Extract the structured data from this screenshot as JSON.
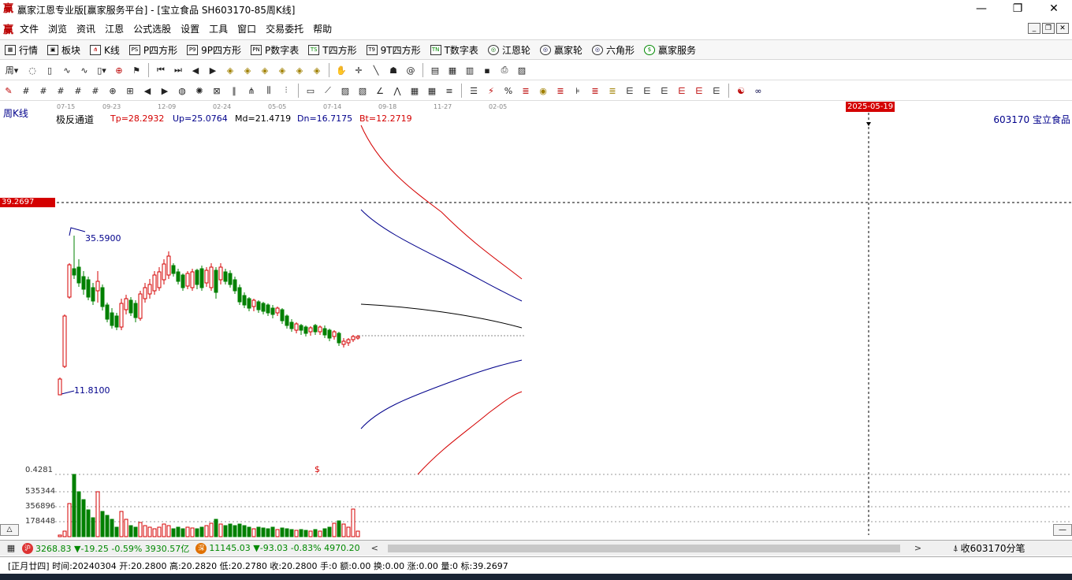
{
  "titlebar": {
    "logo": "赢",
    "title": "赢家江恩专业版[赢家服务平台] - [宝立食品  SH603170-85周K线]",
    "minimize": "—",
    "restore": "❐",
    "close": "✕"
  },
  "menubar": {
    "logo": "赢",
    "items": [
      "文件",
      "浏览",
      "资讯",
      "江恩",
      "公式选股",
      "设置",
      "工具",
      "窗口",
      "交易委托",
      "帮助"
    ],
    "mdi": [
      "_",
      "❐",
      "✕"
    ]
  },
  "navbar": {
    "items": [
      {
        "icon": "quote-grid-icon",
        "glyph": "▦",
        "label": "行情"
      },
      {
        "icon": "sector-icon",
        "glyph": "▣",
        "label": "板块"
      },
      {
        "icon": "kline-icon",
        "glyph": "⋔",
        "label": "K线"
      },
      {
        "icon": "p-square-icon",
        "glyph": "PS",
        "label": "P四方形"
      },
      {
        "icon": "9p-square-icon",
        "glyph": "P9",
        "label": "9P四方形"
      },
      {
        "icon": "p-number-table-icon",
        "glyph": "PN",
        "label": "P数字表"
      },
      {
        "icon": "t-square-icon",
        "glyph": "TS",
        "label": "T四方形"
      },
      {
        "icon": "9t-square-icon",
        "glyph": "T9",
        "label": "9T四方形"
      },
      {
        "icon": "t-number-table-icon",
        "glyph": "TN",
        "label": "T数字表"
      },
      {
        "icon": "gann-wheel-icon",
        "glyph": "◎",
        "label": "江恩轮"
      },
      {
        "icon": "winner-wheel-icon",
        "glyph": "◎",
        "label": "赢家轮"
      },
      {
        "icon": "hexagon-icon",
        "glyph": "◎",
        "label": "六角形"
      },
      {
        "icon": "dollar-icon",
        "glyph": "$",
        "label": "赢家服务"
      }
    ]
  },
  "toolbar1": {
    "period_label": "周"
  },
  "chart": {
    "period_label": "周K线",
    "stock_label": "603170  宝立食品",
    "indicator_name": "极反通道",
    "tp": "Tp=28.2932",
    "up": "Up=25.0764",
    "md": "Md=21.4719",
    "dn": "Dn=16.7175",
    "bt": "Bt=12.2719",
    "date_ticks": [
      "07-15",
      "09-23",
      "12-09",
      "02-24",
      "05-05",
      "07-14",
      "09-18",
      "11-27",
      "02-05"
    ],
    "cursor_date": "2025-05-19",
    "cursor_price": "39.2697",
    "high_label": "35.5900",
    "low_label": "11.8100",
    "volume_labels": [
      "0.4281",
      "535344",
      "356896",
      "178448"
    ],
    "dollar_mark": "$",
    "colors": {
      "up": "#d40000",
      "down": "#008000",
      "tp_line": "#d40000",
      "up_line": "#00008b",
      "md_line": "#000000",
      "cursor_bg": "#d40000"
    }
  },
  "chart_data": {
    "type": "candlestick",
    "period": "weekly",
    "channel": {
      "name": "极反通道",
      "Tp": 28.2932,
      "Up": 25.0764,
      "Md": 21.4719,
      "Dn": 16.7175,
      "Bt": 12.2719
    },
    "extremes": {
      "high": 35.59,
      "low": 11.81
    },
    "cursor": {
      "date": "2025-05-19",
      "price": 39.2697
    }
  },
  "statusbar": {
    "sh_icon": "沪",
    "sh_text": "3268.83 ▼-19.25 -0.59% 3930.57亿",
    "sz_icon": "深",
    "sz_text": "11145.03 ▼-93.03 -0.83% 4970.20",
    "scroll_left": "<",
    "scroll_right": ">",
    "tick_label": "收603170分笔"
  },
  "infobar": {
    "text": "[正月廿四] 时间:20240304 开:20.2800 高:20.2820 低:20.2780 收:20.2800 手:0 额:0.00 换:0.00 涨:0.00 量:0 标:39.2697"
  }
}
